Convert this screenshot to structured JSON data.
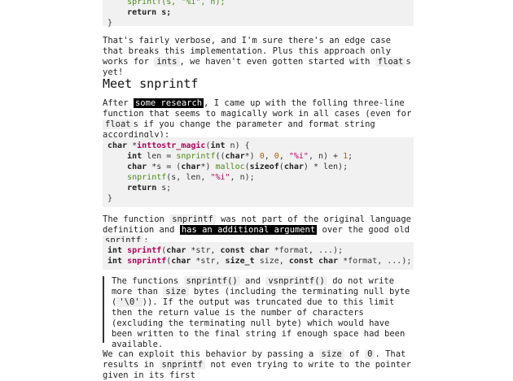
{
  "code_top": {
    "line1": "    sprintf(s, \"%i\", n);",
    "line2": "    return s;",
    "line3": "}"
  },
  "para1": {
    "text1": "That's fairly verbose, and I'm sure there's an edge case that breaks this implementation. Plus this approach only works for ",
    "code1": "ints",
    "text2": ", we haven't even gotten started with ",
    "code2": "float",
    "text3": "s yet!"
  },
  "heading": "Meet snprintf",
  "para2": {
    "text1": "After ",
    "link1": "some research",
    "text2": ", I came up with the folling three-line function that seems to magically work in all cases (even for ",
    "code1": "float",
    "text3": "s if you change the parameter and format string accordingly):"
  },
  "code_main": {
    "l1_kw": "char",
    "l1_star": " *",
    "l1_fn": "inttostr_magic",
    "l1_open": "(",
    "l1_kw2": "int",
    "l1_rest": " n) {",
    "l2_kw": "int",
    "l2_a": " len = ",
    "l2_fn": "snprintf",
    "l2_b": "((",
    "l2_kw2": "char",
    "l2_c": "*) ",
    "l2_n1": "0",
    "l2_d": ", ",
    "l2_n2": "0",
    "l2_e": ", ",
    "l2_str": "\"%i\"",
    "l2_f": ", n) + ",
    "l2_n3": "1",
    "l2_g": ";",
    "l3_kw": "char",
    "l3_a": " *s = (",
    "l3_kw2": "char",
    "l3_b": "*) ",
    "l3_fn": "malloc",
    "l3_c": "(",
    "l3_kw3": "sizeof",
    "l3_d": "(",
    "l3_kw4": "char",
    "l3_e": ") * len);",
    "l4_fn": "snprintf",
    "l4_a": "(s, len, ",
    "l4_str": "\"%i\"",
    "l4_b": ", n);",
    "l5_kw": "return",
    "l5_a": " s;",
    "l6": "}"
  },
  "para3": {
    "text1": "The function ",
    "code1": "snprintf",
    "text2": " was not part of the original language definition and ",
    "link1": "has an additional argument",
    "text3": " over the good old ",
    "code2": "sprintf",
    "text4": ":"
  },
  "code_sig": {
    "a_kw": "int",
    "a_fn": "sprintf",
    "a_1": "(",
    "a_kw2": "char",
    "a_2": " *str, ",
    "a_kw3": "const char",
    "a_3": " *format, ...);",
    "b_kw": "int",
    "b_fn": "snprintf",
    "b_1": "(",
    "b_kw2": "char",
    "b_2": " *str, ",
    "b_kw3": "size_t",
    "b_3": " size, ",
    "b_kw4": "const char",
    "b_4": " *format, ...);"
  },
  "quote": {
    "t1": "The functions ",
    "c1": "snprintf()",
    "t2": " and ",
    "c2": "vsnprintf()",
    "t3": " do not write more than ",
    "c3": "size",
    "t4": " bytes (including the terminating null byte (",
    "c4": "'\\0'",
    "t5": ")). If the output was truncated due to this limit then the return value is the number of characters (excluding the terminating null byte) which would have been written to the final string if enough space had been available."
  },
  "para4": {
    "text1": "We can exploit this behavior by passing a ",
    "code1": "size",
    "text2": " of ",
    "code2": "0",
    "text3": ". That results in ",
    "code3": "snprintf",
    "text4": " not even trying to write to the pointer given in its first"
  }
}
